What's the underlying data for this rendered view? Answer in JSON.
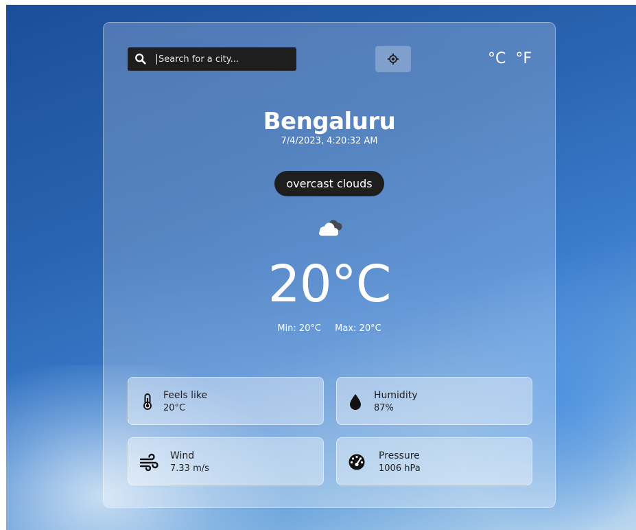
{
  "search": {
    "placeholder": "Search for a city..."
  },
  "units": {
    "celsius": "°C",
    "fahrenheit": "°F"
  },
  "weather": {
    "city": "Bengaluru",
    "datetime": "7/4/2023, 4:20:32 AM",
    "description": "overcast clouds",
    "icon": "cloud-icon",
    "temperature": "20°C",
    "min_label": "Min: 20°C",
    "max_label": "Max: 20°C"
  },
  "details": {
    "feels_like": {
      "label": "Feels like",
      "value": "20°C",
      "icon": "thermometer-icon"
    },
    "humidity": {
      "label": "Humidity",
      "value": "87%",
      "icon": "droplet-icon"
    },
    "wind": {
      "label": "Wind",
      "value": "7.33 m/s",
      "icon": "wind-icon"
    },
    "pressure": {
      "label": "Pressure",
      "value": "1006 hPa",
      "icon": "gauge-icon"
    }
  },
  "colors": {
    "pill_bg": "#1e1e1e",
    "text": "#ffffff",
    "tile_text": "#222222"
  }
}
